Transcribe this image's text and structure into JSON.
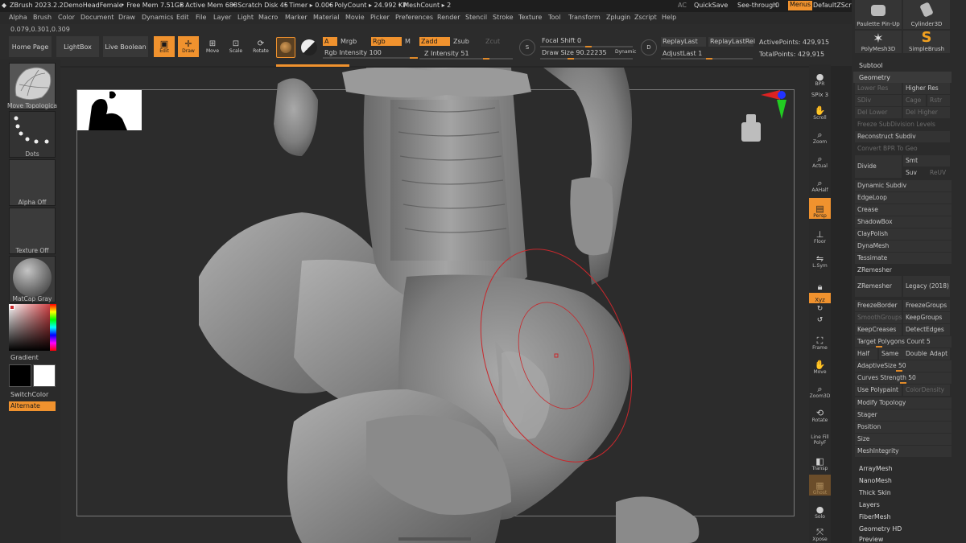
{
  "titlebar": {
    "app": "ZBrush 2023.2.2",
    "project": "DemoHeadFemale",
    "free_mem": "• Free Mem 7.51GB",
    "active_mem": "• Active Mem 688",
    "scratch": "• Scratch Disk 45",
    "timer": "• Timer ▸ 0.006",
    "polycount": "• PolyCount ▸ 24.992 KP",
    "meshcount": "• MeshCount ▸ 2",
    "ac": "AC",
    "quicksave": "QuickSave",
    "seethrough": "See-through",
    "seethrough_val": "0",
    "menus": "Menus",
    "script": "DefaultZScript"
  },
  "menu": [
    "Alpha",
    "Brush",
    "Color",
    "Document",
    "Draw",
    "Dynamics",
    "Edit",
    "File",
    "Layer",
    "Light",
    "Macro",
    "Marker",
    "Material",
    "Movie",
    "Picker",
    "Preferences",
    "Render",
    "Stencil",
    "Stroke",
    "Texture",
    "Tool",
    "Transform",
    "Zplugin",
    "Zscript",
    "Help"
  ],
  "coords": "0.079,0.301,0.309",
  "toolbar": {
    "home": "Home Page",
    "lightbox": "LightBox",
    "liveboolean": "Live Boolean",
    "edit": "Edit",
    "draw": "Draw",
    "move": "Move",
    "scale": "Scale",
    "rotate": "Rotate",
    "a": "A",
    "mrgb": "Mrgb",
    "rgb": "Rgb",
    "m": "M",
    "zadd": "Zadd",
    "zsub": "Zsub",
    "zcut": "Zcut",
    "rgb_intensity": "Rgb Intensity 100",
    "z_intensity": "Z Intensity 51",
    "focal": "Focal Shift 0",
    "drawsize": "Draw Size 90.22235",
    "dynamic": "Dynamic",
    "s": "S",
    "d": "D",
    "replaylast": "ReplayLast",
    "replaylastrel": "ReplayLastRel",
    "adjustlast": "AdjustLast 1",
    "activepoints": "ActivePoints: 429,915",
    "totalpoints": "TotalPoints: 429,915"
  },
  "left": {
    "brush": "Move Topologica",
    "stroke": "Dots",
    "alpha": "Alpha Off",
    "texture": "Texture Off",
    "material": "MatCap Gray",
    "gradient": "Gradient",
    "switchcolor": "SwitchColor",
    "alternate": "Alternate"
  },
  "right_icons": [
    "BPR",
    "SPix 3",
    "Scroll",
    "Zoom",
    "Actual",
    "AAHalf",
    "Persp",
    "Floor",
    "L.Sym",
    "",
    "Xyz",
    "",
    "",
    "Frame",
    "Move",
    "Zoom3D",
    "Rotate",
    "Line Fill PolyF",
    "Transp",
    "Ghost",
    "Solo",
    "Xpose"
  ],
  "subpanel": {
    "tools": [
      "Paulette Pin-Up",
      "Cylinder3D",
      "PolyMesh3D",
      "SimpleBrush"
    ],
    "subtool": "Subtool",
    "geometry": "Geometry",
    "lowerres": "Lower Res",
    "higherres": "Higher Res",
    "sdiv": "SDiv",
    "cage": "Cage",
    "rstr": "Rstr",
    "dellower": "Del Lower",
    "delhigher": "Del Higher",
    "freeze": "Freeze SubDivision Levels",
    "reconstruct": "Reconstruct Subdiv",
    "convert": "Convert BPR To Geo",
    "divide": "Divide",
    "smt": "Smt",
    "suv": "Suv",
    "reuv": "ReUV",
    "dynamic_subdiv": "Dynamic Subdiv",
    "edgeloop": "EdgeLoop",
    "crease": "Crease",
    "shadowbox": "ShadowBox",
    "claypolish": "ClayPolish",
    "dynamesh": "DynaMesh",
    "tessimate": "Tessimate",
    "zremesher_head": "ZRemesher",
    "zremesher": "ZRemesher",
    "legacy": "Legacy (2018)",
    "freezeborder": "FreezeBorder",
    "freezegroups": "FreezeGroups",
    "smoothgroups": "SmoothGroups",
    "keepgroups": "KeepGroups",
    "keepcreases": "KeepCreases",
    "detectedges": "DetectEdges",
    "target": "Target Polygons Count 5",
    "half": "Half",
    "same": "Same",
    "double": "Double",
    "adapt": "Adapt",
    "adaptivesize": "AdaptiveSize 50",
    "curvesstrength": "Curves Strength 50",
    "usepolypaint": "Use Polypaint",
    "colordensity": "ColorDensity",
    "modifytopology": "Modify Topology",
    "stager": "Stager",
    "position": "Position",
    "size": "Size",
    "meshintegrity": "MeshIntegrity",
    "arraymesh": "ArrayMesh",
    "nanomesh": "NanoMesh",
    "thickskin": "Thick Skin",
    "layers": "Layers",
    "fibermesh": "FiberMesh",
    "geometryhd": "Geometry HD",
    "preview": "Preview"
  },
  "colors": {
    "accent": "#f0922e",
    "brush_ring": "#c8282c"
  }
}
